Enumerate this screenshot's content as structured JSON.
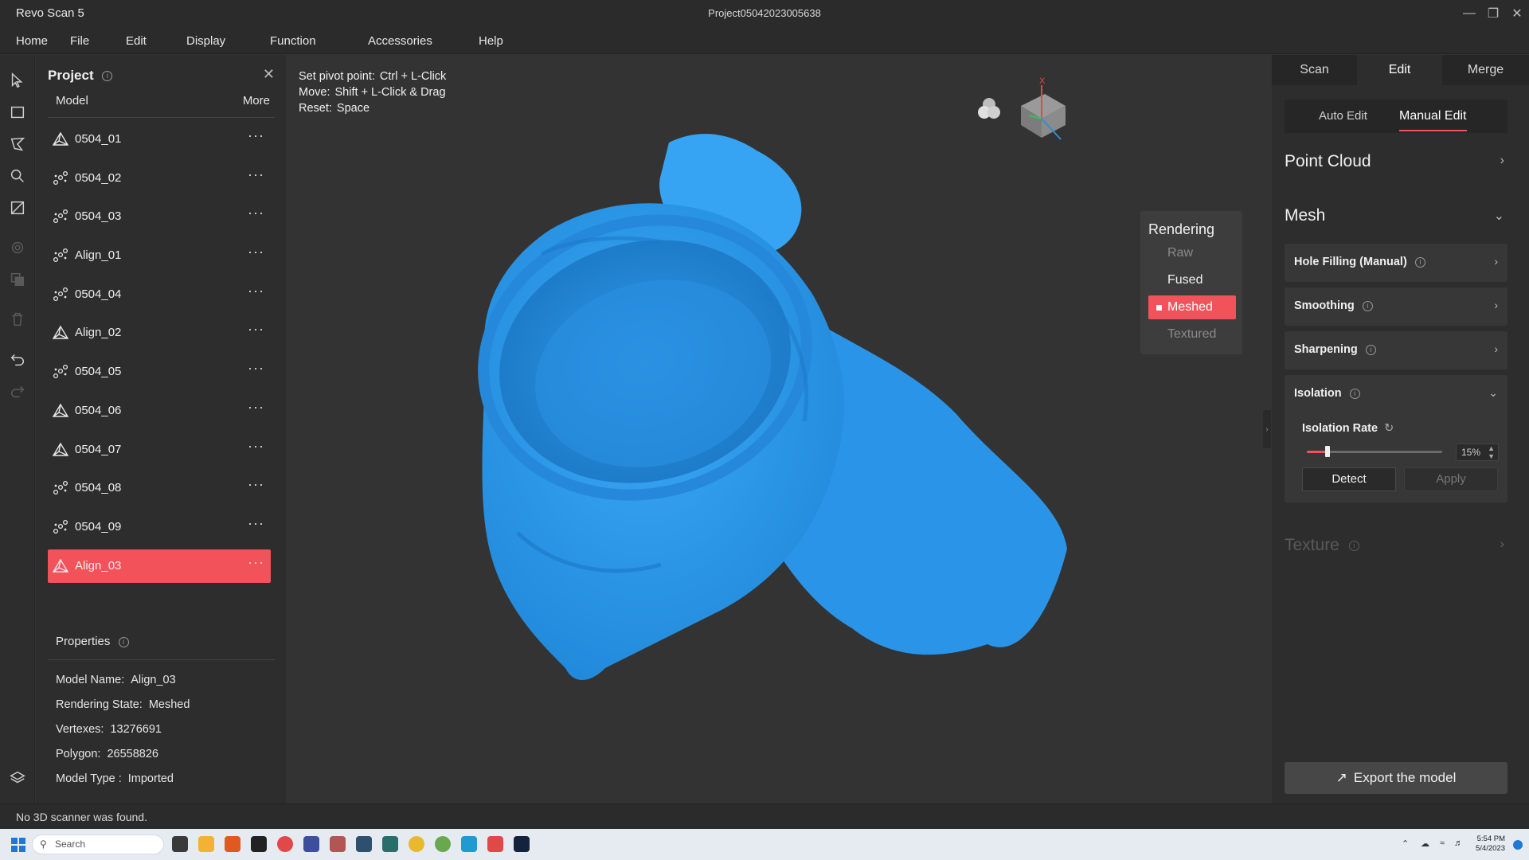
{
  "window": {
    "app_name": "Revo Scan 5",
    "document_title": "Project05042023005638",
    "controls": [
      "minimize-icon",
      "restore-icon",
      "close-icon"
    ]
  },
  "menu": [
    "Home",
    "File",
    "Edit",
    "Display",
    "Function",
    "Accessories",
    "Help"
  ],
  "toolbar": [
    "select-arrow-icon",
    "rectangle-select-icon",
    "lasso-select-icon",
    "brush-select-icon",
    "invert-select-icon",
    "reduce-select-icon",
    "copy-icon",
    "trash-icon",
    "undo-icon",
    "redo-icon",
    "layers-icon"
  ],
  "project": {
    "title": "Project",
    "col_model": "Model",
    "col_more": "More",
    "models": [
      {
        "name": "0504_01",
        "type": "mesh",
        "selected": false
      },
      {
        "name": "0504_02",
        "type": "pointcloud",
        "selected": false
      },
      {
        "name": "0504_03",
        "type": "pointcloud",
        "selected": false
      },
      {
        "name": "Align_01",
        "type": "pointcloud",
        "selected": false
      },
      {
        "name": "0504_04",
        "type": "pointcloud",
        "selected": false
      },
      {
        "name": "Align_02",
        "type": "mesh",
        "selected": false
      },
      {
        "name": "0504_05",
        "type": "pointcloud",
        "selected": false
      },
      {
        "name": "0504_06",
        "type": "mesh",
        "selected": false
      },
      {
        "name": "0504_07",
        "type": "mesh",
        "selected": false
      },
      {
        "name": "0504_08",
        "type": "pointcloud",
        "selected": false
      },
      {
        "name": "0504_09",
        "type": "pointcloud",
        "selected": false
      },
      {
        "name": "Align_03",
        "type": "mesh",
        "selected": true
      }
    ],
    "more_glyph": "···"
  },
  "properties": {
    "title": "Properties",
    "model_name_label": "Model Name:",
    "model_name": "Align_03",
    "rendering_state_label": "Rendering State:",
    "rendering_state": "Meshed",
    "vertexes_label": "Vertexes:",
    "vertexes": "13276691",
    "polygon_label": "Polygon:",
    "polygon": "26558826",
    "model_type_label": "Model Type :",
    "model_type": "Imported"
  },
  "viewport": {
    "hints": [
      {
        "label": "Set pivot point:",
        "value": "Ctrl + L-Click"
      },
      {
        "label": "Move:",
        "value": "Shift + L-Click & Drag"
      },
      {
        "label": "Reset:",
        "value": "Space"
      }
    ],
    "axis_label": "X",
    "rendering": {
      "title": "Rendering",
      "options": [
        "Raw",
        "Fused",
        "Meshed",
        "Textured"
      ],
      "active": "Meshed"
    },
    "model_color": "#2e9bef"
  },
  "right": {
    "tabs": [
      "Scan",
      "Edit",
      "Merge"
    ],
    "active_tab": "Edit",
    "subtabs": [
      "Auto Edit",
      "Manual Edit"
    ],
    "active_subtab": "Manual Edit",
    "point_cloud": "Point Cloud",
    "mesh": "Mesh",
    "hole_filling": "Hole Filling (Manual)",
    "smoothing": "Smoothing",
    "sharpening": "Sharpening",
    "isolation": "Isolation",
    "isolation_rate_label": "Isolation Rate",
    "isolation_rate": 0.15,
    "isolation_rate_text": "15%",
    "detect": "Detect",
    "apply": "Apply",
    "texture": "Texture",
    "export": "Export the model"
  },
  "status": "No 3D scanner was found.",
  "taskbar": {
    "search_placeholder": "Search",
    "time": "5:54 PM",
    "date": "5/4/2023"
  },
  "colors": {
    "accent": "#f2525a",
    "panel": "#2d2d2d",
    "viewport": "#333333"
  }
}
